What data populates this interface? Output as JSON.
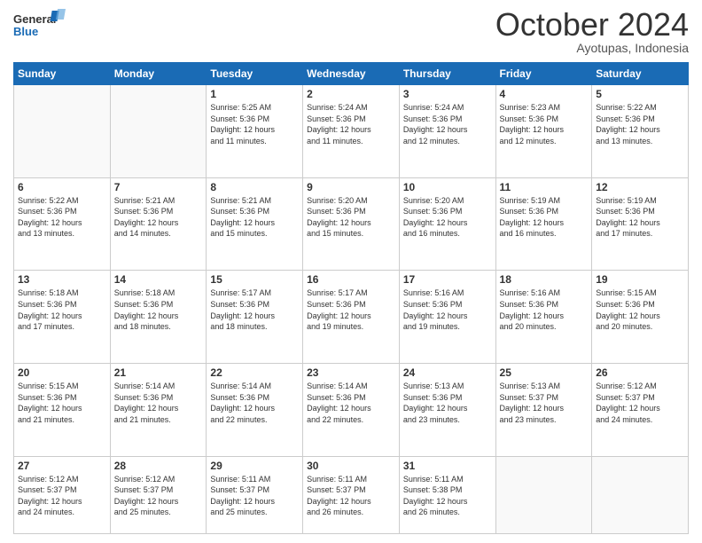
{
  "logo": {
    "line1": "General",
    "line2": "Blue"
  },
  "title": "October 2024",
  "location": "Ayotupas, Indonesia",
  "weekdays": [
    "Sunday",
    "Monday",
    "Tuesday",
    "Wednesday",
    "Thursday",
    "Friday",
    "Saturday"
  ],
  "days": [
    {
      "num": "",
      "info": ""
    },
    {
      "num": "",
      "info": ""
    },
    {
      "num": "1",
      "info": "Sunrise: 5:25 AM\nSunset: 5:36 PM\nDaylight: 12 hours\nand 11 minutes."
    },
    {
      "num": "2",
      "info": "Sunrise: 5:24 AM\nSunset: 5:36 PM\nDaylight: 12 hours\nand 11 minutes."
    },
    {
      "num": "3",
      "info": "Sunrise: 5:24 AM\nSunset: 5:36 PM\nDaylight: 12 hours\nand 12 minutes."
    },
    {
      "num": "4",
      "info": "Sunrise: 5:23 AM\nSunset: 5:36 PM\nDaylight: 12 hours\nand 12 minutes."
    },
    {
      "num": "5",
      "info": "Sunrise: 5:22 AM\nSunset: 5:36 PM\nDaylight: 12 hours\nand 13 minutes."
    },
    {
      "num": "6",
      "info": "Sunrise: 5:22 AM\nSunset: 5:36 PM\nDaylight: 12 hours\nand 13 minutes."
    },
    {
      "num": "7",
      "info": "Sunrise: 5:21 AM\nSunset: 5:36 PM\nDaylight: 12 hours\nand 14 minutes."
    },
    {
      "num": "8",
      "info": "Sunrise: 5:21 AM\nSunset: 5:36 PM\nDaylight: 12 hours\nand 15 minutes."
    },
    {
      "num": "9",
      "info": "Sunrise: 5:20 AM\nSunset: 5:36 PM\nDaylight: 12 hours\nand 15 minutes."
    },
    {
      "num": "10",
      "info": "Sunrise: 5:20 AM\nSunset: 5:36 PM\nDaylight: 12 hours\nand 16 minutes."
    },
    {
      "num": "11",
      "info": "Sunrise: 5:19 AM\nSunset: 5:36 PM\nDaylight: 12 hours\nand 16 minutes."
    },
    {
      "num": "12",
      "info": "Sunrise: 5:19 AM\nSunset: 5:36 PM\nDaylight: 12 hours\nand 17 minutes."
    },
    {
      "num": "13",
      "info": "Sunrise: 5:18 AM\nSunset: 5:36 PM\nDaylight: 12 hours\nand 17 minutes."
    },
    {
      "num": "14",
      "info": "Sunrise: 5:18 AM\nSunset: 5:36 PM\nDaylight: 12 hours\nand 18 minutes."
    },
    {
      "num": "15",
      "info": "Sunrise: 5:17 AM\nSunset: 5:36 PM\nDaylight: 12 hours\nand 18 minutes."
    },
    {
      "num": "16",
      "info": "Sunrise: 5:17 AM\nSunset: 5:36 PM\nDaylight: 12 hours\nand 19 minutes."
    },
    {
      "num": "17",
      "info": "Sunrise: 5:16 AM\nSunset: 5:36 PM\nDaylight: 12 hours\nand 19 minutes."
    },
    {
      "num": "18",
      "info": "Sunrise: 5:16 AM\nSunset: 5:36 PM\nDaylight: 12 hours\nand 20 minutes."
    },
    {
      "num": "19",
      "info": "Sunrise: 5:15 AM\nSunset: 5:36 PM\nDaylight: 12 hours\nand 20 minutes."
    },
    {
      "num": "20",
      "info": "Sunrise: 5:15 AM\nSunset: 5:36 PM\nDaylight: 12 hours\nand 21 minutes."
    },
    {
      "num": "21",
      "info": "Sunrise: 5:14 AM\nSunset: 5:36 PM\nDaylight: 12 hours\nand 21 minutes."
    },
    {
      "num": "22",
      "info": "Sunrise: 5:14 AM\nSunset: 5:36 PM\nDaylight: 12 hours\nand 22 minutes."
    },
    {
      "num": "23",
      "info": "Sunrise: 5:14 AM\nSunset: 5:36 PM\nDaylight: 12 hours\nand 22 minutes."
    },
    {
      "num": "24",
      "info": "Sunrise: 5:13 AM\nSunset: 5:36 PM\nDaylight: 12 hours\nand 23 minutes."
    },
    {
      "num": "25",
      "info": "Sunrise: 5:13 AM\nSunset: 5:37 PM\nDaylight: 12 hours\nand 23 minutes."
    },
    {
      "num": "26",
      "info": "Sunrise: 5:12 AM\nSunset: 5:37 PM\nDaylight: 12 hours\nand 24 minutes."
    },
    {
      "num": "27",
      "info": "Sunrise: 5:12 AM\nSunset: 5:37 PM\nDaylight: 12 hours\nand 24 minutes."
    },
    {
      "num": "28",
      "info": "Sunrise: 5:12 AM\nSunset: 5:37 PM\nDaylight: 12 hours\nand 25 minutes."
    },
    {
      "num": "29",
      "info": "Sunrise: 5:11 AM\nSunset: 5:37 PM\nDaylight: 12 hours\nand 25 minutes."
    },
    {
      "num": "30",
      "info": "Sunrise: 5:11 AM\nSunset: 5:37 PM\nDaylight: 12 hours\nand 26 minutes."
    },
    {
      "num": "31",
      "info": "Sunrise: 5:11 AM\nSunset: 5:38 PM\nDaylight: 12 hours\nand 26 minutes."
    },
    {
      "num": "",
      "info": ""
    },
    {
      "num": "",
      "info": ""
    }
  ]
}
